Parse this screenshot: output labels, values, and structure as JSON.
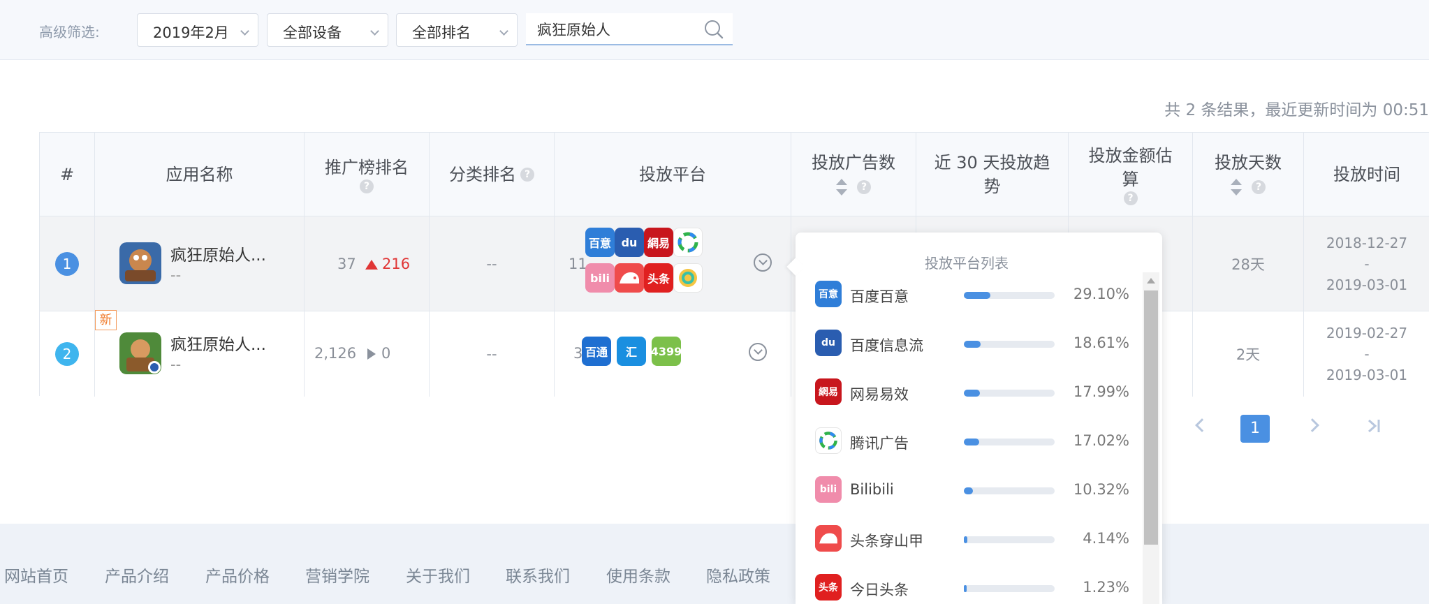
{
  "filters": {
    "label": "高级筛选:",
    "month": "2019年2月",
    "device": "全部设备",
    "ranking": "全部排名",
    "search_value": "疯狂原始人"
  },
  "result_info": "共 2 条结果，最近更新时间为 00:51",
  "table": {
    "headers": {
      "index": "#",
      "app_name": "应用名称",
      "promo_rank": "推广榜排名",
      "category_rank": "分类排名",
      "platform": "投放平台",
      "ad_count": "投放广告数",
      "trend": "近 30 天投放趋势",
      "amount": "投放金额估算",
      "days": "投放天数",
      "time": "投放时间"
    },
    "rows": [
      {
        "index": "1",
        "name": "疯狂原始人...",
        "sub": "--",
        "promo_rank": "37",
        "promo_change": "216",
        "category_rank": "--",
        "platform_count": "11",
        "days": "28天",
        "start": "2018-12-27",
        "dash": "-",
        "end": "2019-03-01"
      },
      {
        "index": "2",
        "new_tag": "新",
        "name": "疯狂原始人...",
        "sub": "--",
        "promo_rank": "2,126",
        "promo_change": "0",
        "category_rank": "--",
        "platform_count": "3",
        "days": "2天",
        "start": "2019-02-27",
        "dash": "-",
        "end": "2019-03-01"
      }
    ],
    "row1_platform_icons": [
      {
        "icon": "baidu-baiyi-icon",
        "text": "百意",
        "color": "#2f7ed8"
      },
      {
        "icon": "baidu-paw-icon",
        "text": "du",
        "color": "#2a5db0"
      },
      {
        "icon": "netease-icon",
        "text": "網易",
        "color": "#c8161d"
      },
      {
        "icon": "tencent-ad-icon",
        "text": "",
        "color": "#ffffff"
      },
      {
        "icon": "bilibili-icon",
        "text": "bili",
        "color": "#f08cab"
      },
      {
        "icon": "pangolin-icon",
        "text": "",
        "color": "#ef4b4b"
      },
      {
        "icon": "toutiao-icon",
        "text": "头条",
        "color": "#e02020"
      },
      {
        "icon": "spiral-icon",
        "text": "",
        "color": "#ffffff"
      }
    ],
    "row2_platform_icons": [
      {
        "icon": "baitong-icon",
        "text": "百通",
        "color": "#1f6fd1"
      },
      {
        "icon": "huichuan-icon",
        "text": "汇",
        "color": "#1a8fe0"
      },
      {
        "icon": "4399-icon",
        "text": "4399",
        "color": "#7cc04a"
      }
    ]
  },
  "pagination": {
    "current": "1"
  },
  "footer": {
    "links": [
      "网站首页",
      "产品介绍",
      "产品价格",
      "营销学院",
      "关于我们",
      "联系我们",
      "使用条款",
      "隐私政策"
    ]
  },
  "popover": {
    "title": "投放平台列表",
    "items": [
      {
        "name": "百度百意",
        "percent": "29.10%",
        "value": 29.1,
        "icon_text": "百意",
        "color": "#2f7ed8"
      },
      {
        "name": "百度信息流",
        "percent": "18.61%",
        "value": 18.61,
        "icon_text": "du",
        "color": "#2a5db0"
      },
      {
        "name": "网易易效",
        "percent": "17.99%",
        "value": 17.99,
        "icon_text": "網易",
        "color": "#c8161d"
      },
      {
        "name": "腾讯广告",
        "percent": "17.02%",
        "value": 17.02,
        "icon_text": "",
        "color": "#ffffff"
      },
      {
        "name": "Bilibili",
        "percent": "10.32%",
        "value": 10.32,
        "icon_text": "bili",
        "color": "#f08cab"
      },
      {
        "name": "头条穿山甲",
        "percent": "4.14%",
        "value": 4.14,
        "icon_text": "",
        "color": "#ef4b4b"
      },
      {
        "name": "今日头条",
        "percent": "1.23%",
        "value": 1.23,
        "icon_text": "头条",
        "color": "#e02020"
      }
    ]
  },
  "colors": {
    "accent": "#4a90e2",
    "rank_badge_1": "#4a90e2",
    "rank_badge_2": "#3fb5ee",
    "rank_up": "#e03535"
  }
}
